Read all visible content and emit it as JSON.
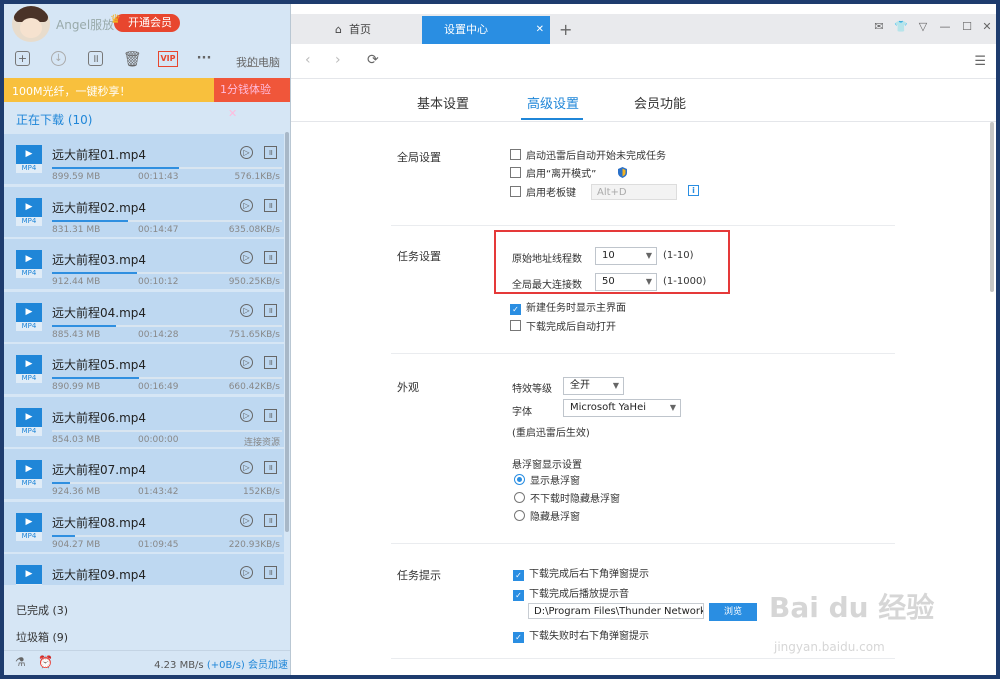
{
  "user": {
    "name": "Angel服放",
    "vip_label": "开通会员"
  },
  "left_toolbar": {
    "my_pc": "我的电脑"
  },
  "promo": {
    "text": "100M光纤，一键秒享！",
    "action": "1分钱体验"
  },
  "downloading_label": "正在下载 (10)",
  "downloads": [
    {
      "name": "远大前程01.mp4",
      "size": "899.59 MB",
      "time": "00:11:43",
      "speed": "576.1KB/s",
      "progress": 0.55,
      "ext": "MP4"
    },
    {
      "name": "远大前程02.mp4",
      "size": "831.31 MB",
      "time": "00:14:47",
      "speed": "635.08KB/s",
      "progress": 0.33,
      "ext": "MP4"
    },
    {
      "name": "远大前程03.mp4",
      "size": "912.44 MB",
      "time": "00:10:12",
      "speed": "950.25KB/s",
      "progress": 0.37,
      "ext": "MP4"
    },
    {
      "name": "远大前程04.mp4",
      "size": "885.43 MB",
      "time": "00:14:28",
      "speed": "751.65KB/s",
      "progress": 0.28,
      "ext": "MP4"
    },
    {
      "name": "远大前程05.mp4",
      "size": "890.99 MB",
      "time": "00:16:49",
      "speed": "660.42KB/s",
      "progress": 0.38,
      "ext": "MP4"
    },
    {
      "name": "远大前程06.mp4",
      "size": "854.03 MB",
      "time": "00:00:00",
      "speed": "连接资源",
      "progress": 0.0,
      "ext": "MP4"
    },
    {
      "name": "远大前程07.mp4",
      "size": "924.36 MB",
      "time": "01:43:42",
      "speed": "152KB/s",
      "progress": 0.08,
      "ext": "MP4"
    },
    {
      "name": "远大前程08.mp4",
      "size": "904.27 MB",
      "time": "01:09:45",
      "speed": "220.93KB/s",
      "progress": 0.1,
      "ext": "MP4"
    },
    {
      "name": "远大前程09.mp4",
      "size": "",
      "time": "",
      "speed": "",
      "progress": 0.2,
      "ext": "MP4"
    }
  ],
  "completed_label": "已完成 (3)",
  "trash_label": "垃圾箱 (9)",
  "footer": {
    "speed": "4.23 MB/s",
    "up": "(+0B/s)",
    "accel": "会员加速"
  },
  "tabs": {
    "home": "首页",
    "settings": "设置中心"
  },
  "setting_tabs": {
    "basic": "基本设置",
    "advanced": "高级设置",
    "member": "会员功能"
  },
  "global": {
    "title": "全局设置",
    "opt1": "启动迅雷后自动开始未完成任务",
    "opt2": "启用“离开模式”",
    "opt3": "启用老板键",
    "hotkey": "Alt+D"
  },
  "task": {
    "title": "任务设置",
    "threads_label": "原始地址线程数",
    "threads_value": "10",
    "threads_range": "(1-10)",
    "conn_label": "全局最大连接数",
    "conn_value": "50",
    "conn_range": "(1-1000)",
    "opt1": "新建任务时显示主界面",
    "opt2": "下载完成后自动打开"
  },
  "appearance": {
    "title": "外观",
    "effect_label": "特效等级",
    "effect_value": "全开",
    "font_label": "字体",
    "font_value": "Microsoft YaHei",
    "note": "(重启迅雷后生效)",
    "float_title": "悬浮窗显示设置",
    "r1": "显示悬浮窗",
    "r2": "不下载时隐藏悬浮窗",
    "r3": "隐藏悬浮窗"
  },
  "notify": {
    "title": "任务提示",
    "opt1": "下载完成后右下角弹窗提示",
    "opt2": "下载完成后播放提示音",
    "path": "D:\\Program Files\\Thunder Network",
    "browse": "浏览",
    "opt3": "下载失败时右下角弹窗提示"
  },
  "watermark": {
    "text": "Bai du 经验",
    "url": "jingyan.baidu.com"
  },
  "colors": {
    "accent": "#2a8ee2",
    "highlight": "#e53939",
    "vip": "#e8462e"
  }
}
